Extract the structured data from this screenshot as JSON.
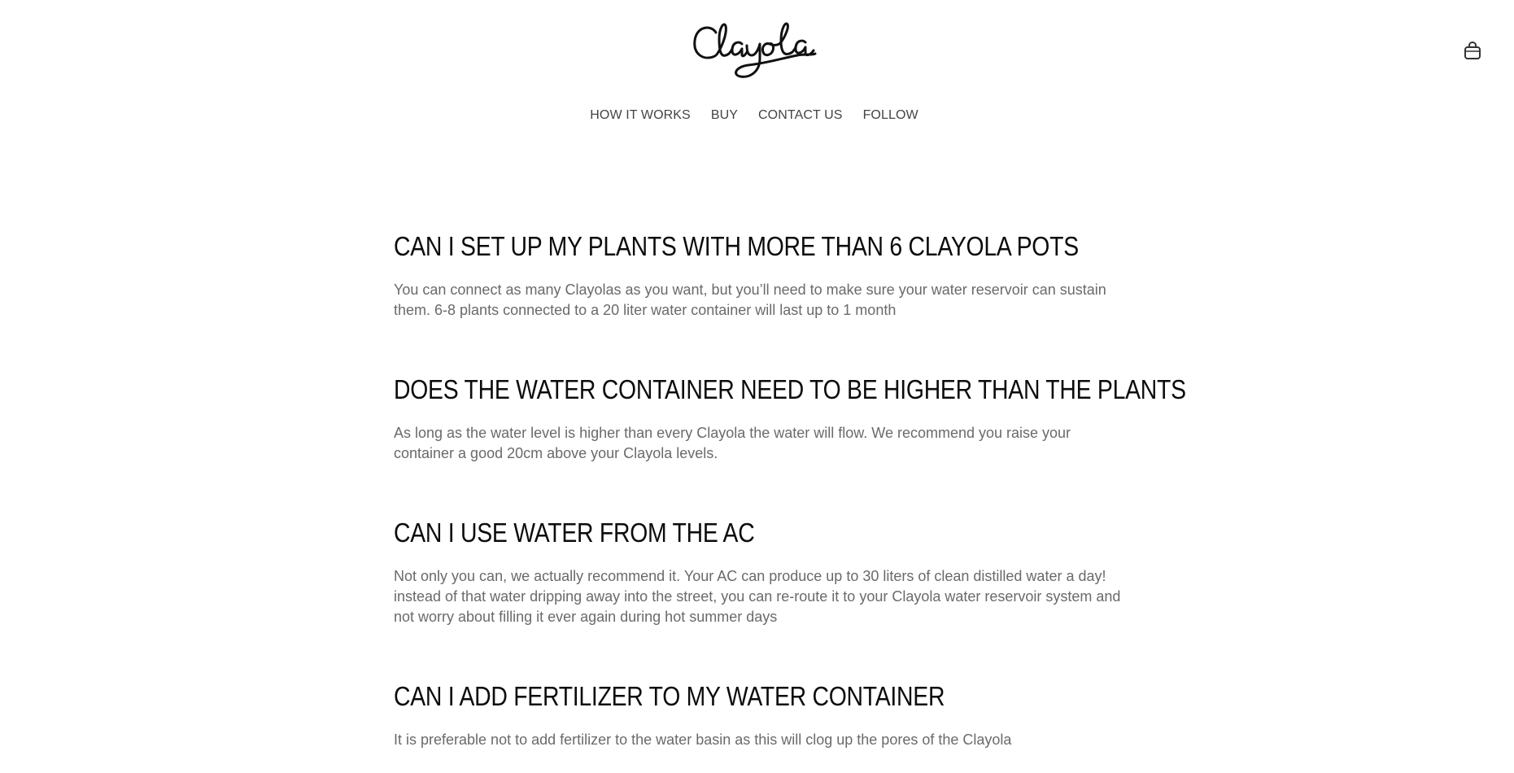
{
  "brand": {
    "logo_text": "Clayola"
  },
  "header": {
    "cart_icon": "shopping-bag-icon"
  },
  "nav": {
    "items": [
      {
        "label": "HOW IT WORKS"
      },
      {
        "label": "BUY"
      },
      {
        "label": "CONTACT US"
      },
      {
        "label": "FOLLOW"
      }
    ]
  },
  "faq": [
    {
      "question": "CAN I SET UP MY PLANTS WITH MORE THAN 6 CLAYOLA POTS",
      "answer": "You can connect as many Clayolas as you want, but you’ll need to make sure your water reservoir can sustain them. 6-8 plants connected to a 20 liter water container will last up to 1 month"
    },
    {
      "question": "DOES THE WATER CONTAINER NEED TO BE HIGHER THAN THE PLANTS",
      "answer": "As long as the water level is higher than every Clayola the water will flow. We recommend you raise your container a good 20cm above your Clayola levels."
    },
    {
      "question": "CAN I USE WATER FROM THE AC",
      "answer": "Not only you can, we actually recommend it. Your AC can produce up to 30 liters of clean distilled water a day! instead of that water dripping away into the street, you can re-route it to your Clayola water reservoir system and not worry about filling it ever again during hot summer days"
    },
    {
      "question": "CAN I ADD FERTILIZER TO MY WATER CONTAINER",
      "answer": "It is preferable not to add fertilizer to the water basin as this will clog up the pores of the Clayola"
    }
  ]
}
